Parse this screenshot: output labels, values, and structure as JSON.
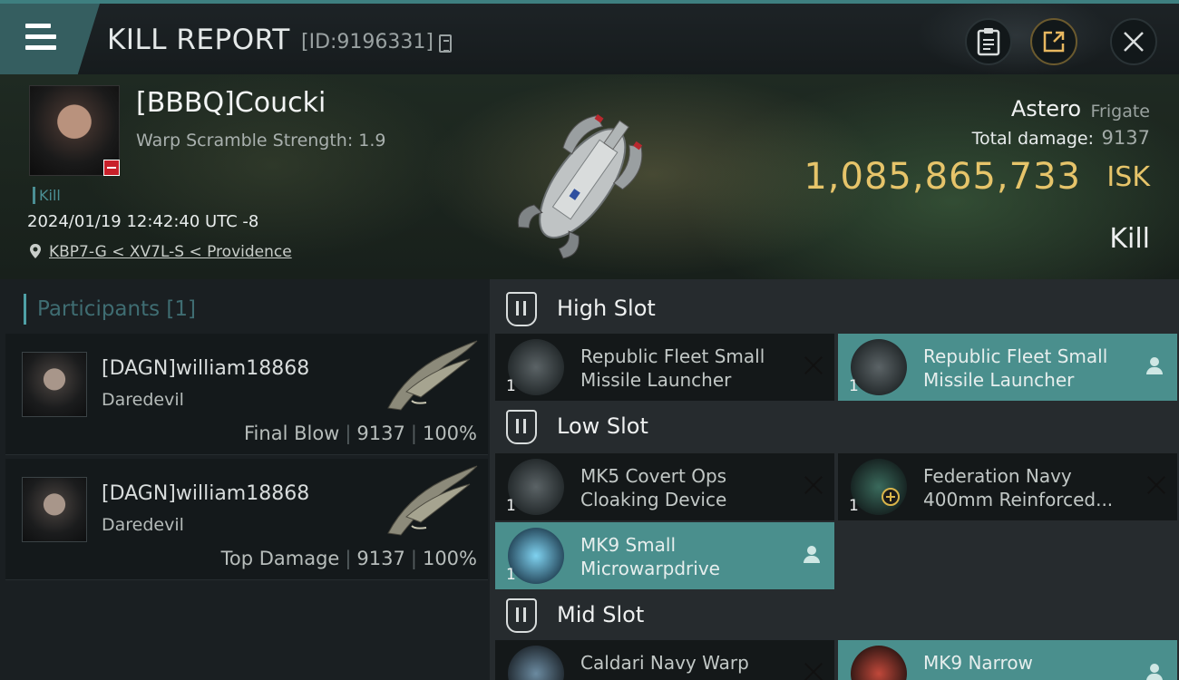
{
  "header": {
    "title": "KILL REPORT",
    "report_id": "[ID:9196331]"
  },
  "victim": {
    "name": "[BBBQ]Coucki",
    "warp_scramble": "Warp Scramble Strength: 1.9",
    "kill_tag": "Kill",
    "datetime": "2024/01/19 12:42:40 UTC -8",
    "location": "KBP7-G < XV7L-S < Providence"
  },
  "ship": {
    "name": "Astero",
    "class": "Frigate",
    "total_damage_label": "Total damage:",
    "total_damage": "9137",
    "isk_value": "1,085,865,733",
    "isk_unit": "ISK",
    "result": "Kill"
  },
  "participants": {
    "label": "Participants",
    "count": "[1]",
    "rows": [
      {
        "name": "[DAGN]william18868",
        "ship": "Daredevil",
        "role": "Final Blow",
        "damage": "9137",
        "percent": "100%"
      },
      {
        "name": "[DAGN]william18868",
        "ship": "Daredevil",
        "role": "Top Damage",
        "damage": "9137",
        "percent": "100%"
      }
    ]
  },
  "fitting": {
    "high_slot": {
      "title": "High Slot",
      "items": [
        {
          "qty": "1",
          "name_line1": "Republic Fleet Small",
          "name_line2": "Missile Launcher",
          "status": "destroyed"
        },
        {
          "qty": "1",
          "name_line1": "Republic Fleet Small",
          "name_line2": "Missile Launcher",
          "status": "dropped"
        }
      ]
    },
    "low_slot": {
      "title": "Low Slot",
      "items": [
        {
          "qty": "1",
          "name_line1": "MK5 Covert Ops",
          "name_line2": "Cloaking Device",
          "status": "destroyed"
        },
        {
          "qty": "1",
          "name_line1": "Federation Navy",
          "name_line2": "400mm Reinforced...",
          "status": "destroyed"
        },
        {
          "qty": "1",
          "name_line1": "MK9 Small",
          "name_line2": "Microwarpdrive",
          "status": "dropped"
        }
      ]
    },
    "mid_slot": {
      "title": "Mid Slot",
      "items": [
        {
          "qty": "",
          "name_line1": "Caldari Navy Warp",
          "name_line2": "",
          "status": "destroyed"
        },
        {
          "qty": "",
          "name_line1": "MK9 Narrow",
          "name_line2": "",
          "status": "dropped"
        }
      ]
    }
  },
  "colors": {
    "accent": "#4a8f8d",
    "isk": "#e6c46a",
    "header_accent": "#355e60"
  },
  "icons": {
    "menu": "menu-icon",
    "clipboard": "clipboard-icon",
    "share": "share-icon",
    "close": "close-icon",
    "pin": "location-pin-icon",
    "dropped": "person-icon",
    "destroyed": "x-icon"
  }
}
